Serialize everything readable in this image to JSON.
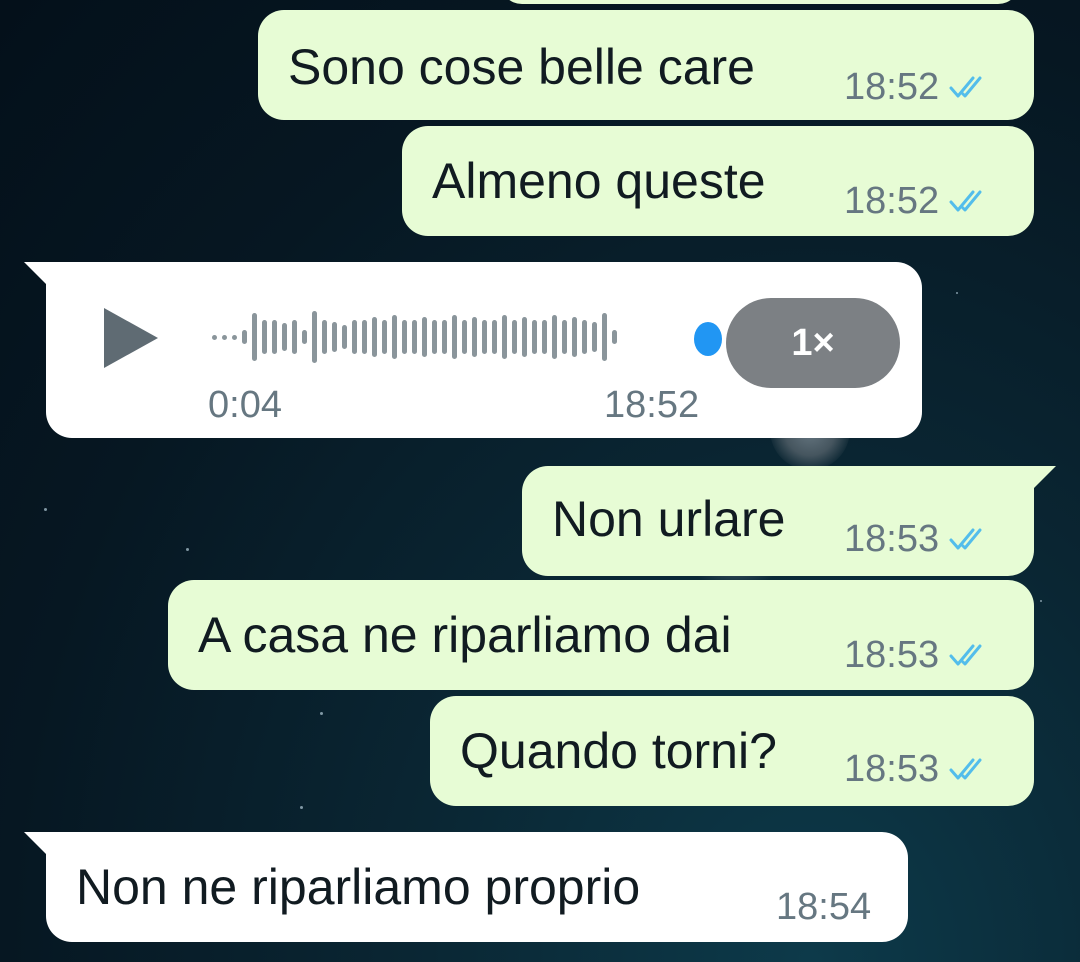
{
  "chat": {
    "messages": [
      {
        "direction": "out",
        "text": "Sono cose belle care",
        "time": "18:52",
        "status": "read"
      },
      {
        "direction": "out",
        "text": "Almeno queste",
        "time": "18:52",
        "status": "read"
      },
      {
        "direction": "in",
        "type": "voice",
        "duration": "0:04",
        "time": "18:52",
        "speed": "1×"
      },
      {
        "direction": "out",
        "text": "Non urlare",
        "time": "18:53",
        "status": "read"
      },
      {
        "direction": "out",
        "text": "A casa ne riparliamo dai",
        "time": "18:53",
        "status": "read"
      },
      {
        "direction": "out",
        "text": "Quando torni?",
        "time": "18:53",
        "status": "read"
      },
      {
        "direction": "in",
        "text": "Non ne riparliamo proprio",
        "time": "18:54"
      }
    ]
  },
  "icons": {
    "read_receipt": "double-check-icon",
    "play": "play-icon"
  },
  "colors": {
    "outgoing_bubble": "#e7fcd5",
    "incoming_bubble": "#ffffff",
    "read_tick": "#53bdeb",
    "voice_progress": "#2196f3",
    "speed_pill": "#7c8084"
  }
}
